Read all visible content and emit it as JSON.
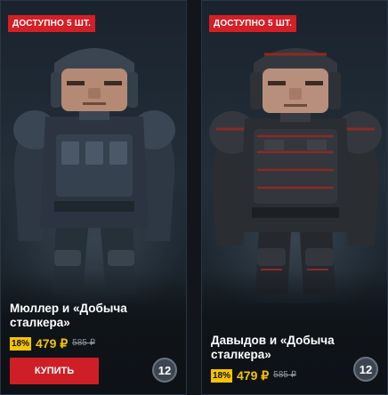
{
  "cards": [
    {
      "badge": "ДОСТУПНО 5 ШТ.",
      "title": "Мюллер и «Добыча сталкера»",
      "discount": "18%",
      "price": "479 ₽",
      "old_price": "585 ₽",
      "buy_label": "КУПИТЬ",
      "level": "12",
      "armor_color": "#2b3440",
      "accent_color": "#4a5868"
    },
    {
      "badge": "ДОСТУПНО 5 ШТ.",
      "title": "Давыдов и «Добыча сталкера»",
      "discount": "18%",
      "price": "479 ₽",
      "old_price": "585 ₽",
      "level": "12",
      "armor_color": "#2a2d32",
      "accent_color": "#8a2a24"
    }
  ],
  "colors": {
    "badge": "#d51f26",
    "discount": "#f5c400",
    "price": "#f5c400",
    "buy_button": "#cf1f26",
    "border": "#2a3542"
  }
}
